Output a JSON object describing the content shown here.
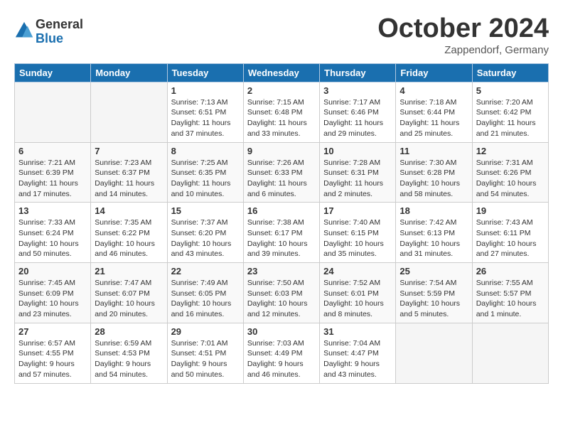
{
  "logo": {
    "text_general": "General",
    "text_blue": "Blue"
  },
  "title": "October 2024",
  "location": "Zappendorf, Germany",
  "days_of_week": [
    "Sunday",
    "Monday",
    "Tuesday",
    "Wednesday",
    "Thursday",
    "Friday",
    "Saturday"
  ],
  "weeks": [
    [
      {
        "day": "",
        "empty": true
      },
      {
        "day": "",
        "empty": true
      },
      {
        "day": "1",
        "sunrise": "Sunrise: 7:13 AM",
        "sunset": "Sunset: 6:51 PM",
        "daylight": "Daylight: 11 hours and 37 minutes."
      },
      {
        "day": "2",
        "sunrise": "Sunrise: 7:15 AM",
        "sunset": "Sunset: 6:48 PM",
        "daylight": "Daylight: 11 hours and 33 minutes."
      },
      {
        "day": "3",
        "sunrise": "Sunrise: 7:17 AM",
        "sunset": "Sunset: 6:46 PM",
        "daylight": "Daylight: 11 hours and 29 minutes."
      },
      {
        "day": "4",
        "sunrise": "Sunrise: 7:18 AM",
        "sunset": "Sunset: 6:44 PM",
        "daylight": "Daylight: 11 hours and 25 minutes."
      },
      {
        "day": "5",
        "sunrise": "Sunrise: 7:20 AM",
        "sunset": "Sunset: 6:42 PM",
        "daylight": "Daylight: 11 hours and 21 minutes."
      }
    ],
    [
      {
        "day": "6",
        "sunrise": "Sunrise: 7:21 AM",
        "sunset": "Sunset: 6:39 PM",
        "daylight": "Daylight: 11 hours and 17 minutes."
      },
      {
        "day": "7",
        "sunrise": "Sunrise: 7:23 AM",
        "sunset": "Sunset: 6:37 PM",
        "daylight": "Daylight: 11 hours and 14 minutes."
      },
      {
        "day": "8",
        "sunrise": "Sunrise: 7:25 AM",
        "sunset": "Sunset: 6:35 PM",
        "daylight": "Daylight: 11 hours and 10 minutes."
      },
      {
        "day": "9",
        "sunrise": "Sunrise: 7:26 AM",
        "sunset": "Sunset: 6:33 PM",
        "daylight": "Daylight: 11 hours and 6 minutes."
      },
      {
        "day": "10",
        "sunrise": "Sunrise: 7:28 AM",
        "sunset": "Sunset: 6:31 PM",
        "daylight": "Daylight: 11 hours and 2 minutes."
      },
      {
        "day": "11",
        "sunrise": "Sunrise: 7:30 AM",
        "sunset": "Sunset: 6:28 PM",
        "daylight": "Daylight: 10 hours and 58 minutes."
      },
      {
        "day": "12",
        "sunrise": "Sunrise: 7:31 AM",
        "sunset": "Sunset: 6:26 PM",
        "daylight": "Daylight: 10 hours and 54 minutes."
      }
    ],
    [
      {
        "day": "13",
        "sunrise": "Sunrise: 7:33 AM",
        "sunset": "Sunset: 6:24 PM",
        "daylight": "Daylight: 10 hours and 50 minutes."
      },
      {
        "day": "14",
        "sunrise": "Sunrise: 7:35 AM",
        "sunset": "Sunset: 6:22 PM",
        "daylight": "Daylight: 10 hours and 46 minutes."
      },
      {
        "day": "15",
        "sunrise": "Sunrise: 7:37 AM",
        "sunset": "Sunset: 6:20 PM",
        "daylight": "Daylight: 10 hours and 43 minutes."
      },
      {
        "day": "16",
        "sunrise": "Sunrise: 7:38 AM",
        "sunset": "Sunset: 6:17 PM",
        "daylight": "Daylight: 10 hours and 39 minutes."
      },
      {
        "day": "17",
        "sunrise": "Sunrise: 7:40 AM",
        "sunset": "Sunset: 6:15 PM",
        "daylight": "Daylight: 10 hours and 35 minutes."
      },
      {
        "day": "18",
        "sunrise": "Sunrise: 7:42 AM",
        "sunset": "Sunset: 6:13 PM",
        "daylight": "Daylight: 10 hours and 31 minutes."
      },
      {
        "day": "19",
        "sunrise": "Sunrise: 7:43 AM",
        "sunset": "Sunset: 6:11 PM",
        "daylight": "Daylight: 10 hours and 27 minutes."
      }
    ],
    [
      {
        "day": "20",
        "sunrise": "Sunrise: 7:45 AM",
        "sunset": "Sunset: 6:09 PM",
        "daylight": "Daylight: 10 hours and 23 minutes."
      },
      {
        "day": "21",
        "sunrise": "Sunrise: 7:47 AM",
        "sunset": "Sunset: 6:07 PM",
        "daylight": "Daylight: 10 hours and 20 minutes."
      },
      {
        "day": "22",
        "sunrise": "Sunrise: 7:49 AM",
        "sunset": "Sunset: 6:05 PM",
        "daylight": "Daylight: 10 hours and 16 minutes."
      },
      {
        "day": "23",
        "sunrise": "Sunrise: 7:50 AM",
        "sunset": "Sunset: 6:03 PM",
        "daylight": "Daylight: 10 hours and 12 minutes."
      },
      {
        "day": "24",
        "sunrise": "Sunrise: 7:52 AM",
        "sunset": "Sunset: 6:01 PM",
        "daylight": "Daylight: 10 hours and 8 minutes."
      },
      {
        "day": "25",
        "sunrise": "Sunrise: 7:54 AM",
        "sunset": "Sunset: 5:59 PM",
        "daylight": "Daylight: 10 hours and 5 minutes."
      },
      {
        "day": "26",
        "sunrise": "Sunrise: 7:55 AM",
        "sunset": "Sunset: 5:57 PM",
        "daylight": "Daylight: 10 hours and 1 minute."
      }
    ],
    [
      {
        "day": "27",
        "sunrise": "Sunrise: 6:57 AM",
        "sunset": "Sunset: 4:55 PM",
        "daylight": "Daylight: 9 hours and 57 minutes."
      },
      {
        "day": "28",
        "sunrise": "Sunrise: 6:59 AM",
        "sunset": "Sunset: 4:53 PM",
        "daylight": "Daylight: 9 hours and 54 minutes."
      },
      {
        "day": "29",
        "sunrise": "Sunrise: 7:01 AM",
        "sunset": "Sunset: 4:51 PM",
        "daylight": "Daylight: 9 hours and 50 minutes."
      },
      {
        "day": "30",
        "sunrise": "Sunrise: 7:03 AM",
        "sunset": "Sunset: 4:49 PM",
        "daylight": "Daylight: 9 hours and 46 minutes."
      },
      {
        "day": "31",
        "sunrise": "Sunrise: 7:04 AM",
        "sunset": "Sunset: 4:47 PM",
        "daylight": "Daylight: 9 hours and 43 minutes."
      },
      {
        "day": "",
        "empty": true
      },
      {
        "day": "",
        "empty": true
      }
    ]
  ]
}
